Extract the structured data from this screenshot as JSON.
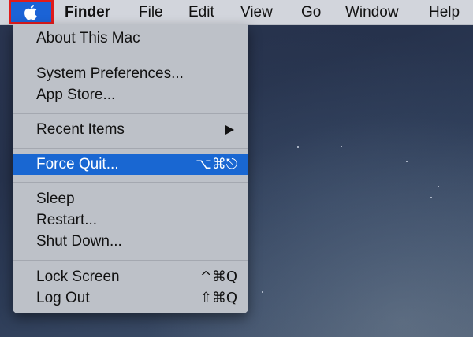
{
  "menubar": {
    "apple_icon": "apple-logo-icon",
    "items": [
      {
        "label": "Finder"
      },
      {
        "label": "File"
      },
      {
        "label": "Edit"
      },
      {
        "label": "View"
      },
      {
        "label": "Go"
      },
      {
        "label": "Window"
      },
      {
        "label": "Help"
      }
    ]
  },
  "apple_menu": {
    "items": [
      {
        "label": "About This Mac",
        "shortcut": ""
      },
      {
        "label": "System Preferences...",
        "shortcut": ""
      },
      {
        "label": "App Store...",
        "shortcut": ""
      },
      {
        "label": "Recent Items",
        "shortcut": "",
        "submenu_icon": "triangle-right-icon"
      },
      {
        "label": "Force Quit...",
        "shortcut": "⌥⌘⎋",
        "highlighted": true
      },
      {
        "label": "Sleep",
        "shortcut": ""
      },
      {
        "label": "Restart...",
        "shortcut": ""
      },
      {
        "label": "Shut Down...",
        "shortcut": ""
      },
      {
        "label": "Lock Screen",
        "shortcut": "^⌘Q"
      },
      {
        "label": "Log Out",
        "shortcut": "⇧⌘Q"
      }
    ]
  },
  "colors": {
    "highlight": "#1967d2",
    "apple_box_fill": "#1b63d6",
    "apple_box_border": "#e01b1b",
    "menubar": "#d2d5dc",
    "menu_bg": "#bdc1c8"
  }
}
